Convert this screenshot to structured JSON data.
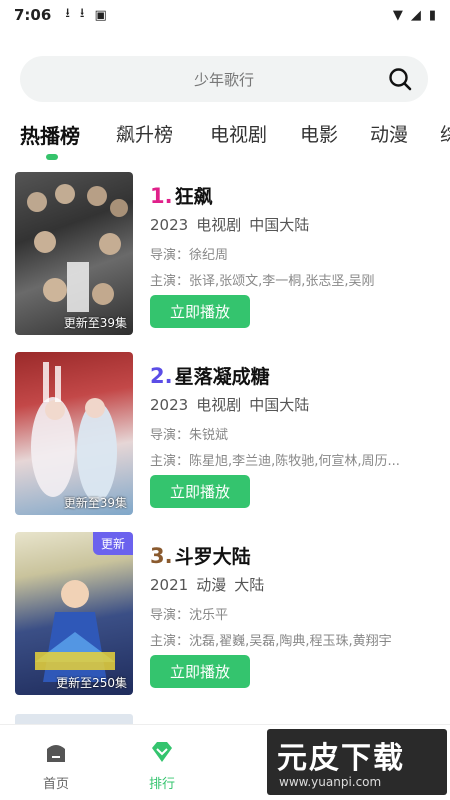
{
  "status_bar": {
    "time": "7:06"
  },
  "search": {
    "placeholder": "少年歌行"
  },
  "tabs": [
    "热播榜",
    "飙升榜",
    "电视剧",
    "电影",
    "动漫",
    "综"
  ],
  "items": [
    {
      "rank": "1.",
      "rank_color": "#e0208a",
      "title": "狂飙",
      "year": "2023",
      "type": "电视剧",
      "region": "中国大陆",
      "director": "导演：徐纪周",
      "cast": "主演：张译,张颂文,李一桐,张志坚,吴刚",
      "update": "更新至39集",
      "badge": "",
      "button": "立即播放"
    },
    {
      "rank": "2.",
      "rank_color": "#5b4de6",
      "title": "星落凝成糖",
      "year": "2023",
      "type": "电视剧",
      "region": "中国大陆",
      "director": "导演：朱锐斌",
      "cast": "主演：陈星旭,李兰迪,陈牧驰,何宣林,周历...",
      "update": "更新至39集",
      "badge": "",
      "button": "立即播放"
    },
    {
      "rank": "3.",
      "rank_color": "#8a5a2e",
      "title": "斗罗大陆",
      "year": "2021",
      "type": "动漫",
      "region": "大陆",
      "director": "导演：沈乐平",
      "cast": "主演：沈磊,翟巍,吴磊,陶典,程玉珠,黄翔宇",
      "update": "更新至250集",
      "badge": "更新",
      "button": "立即播放"
    }
  ],
  "bottom_nav": [
    {
      "label": "首页"
    },
    {
      "label": "排行"
    }
  ],
  "watermark": {
    "text": "元皮下载",
    "url": "www.yuanpi.com"
  },
  "colors": {
    "accent": "#34c46e",
    "badge": "#6b62ee"
  }
}
